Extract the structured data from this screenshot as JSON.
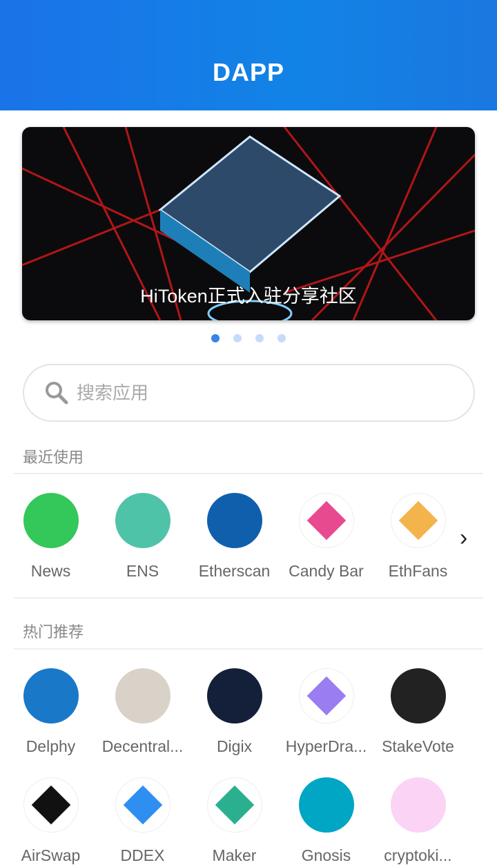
{
  "header": {
    "title": "DAPP"
  },
  "banner": {
    "caption": "HiToken正式入驻分享社区",
    "slides": 4,
    "active": 0
  },
  "search": {
    "placeholder": "搜索应用"
  },
  "recent": {
    "title": "最近使用",
    "apps": [
      {
        "name": "News",
        "color": "#34c759"
      },
      {
        "name": "ENS",
        "color": "#4fc3a8"
      },
      {
        "name": "Etherscan",
        "color": "#0f5fad"
      },
      {
        "name": "Candy Bar",
        "color": "#e84a8f"
      },
      {
        "name": "EthFans",
        "color": "#f2b44b"
      }
    ]
  },
  "hot": {
    "title": "热门推荐",
    "apps": [
      {
        "name": "Delphy",
        "color": "#1a78c8"
      },
      {
        "name": "Decentral...",
        "color": "#d8d2c8"
      },
      {
        "name": "Digix",
        "color": "#14203a"
      },
      {
        "name": "HyperDra...",
        "color": "#9a7df0"
      },
      {
        "name": "StakeVote",
        "color": "#222222"
      },
      {
        "name": "AirSwap",
        "color": "#111111"
      },
      {
        "name": "DDEX",
        "color": "#2f8ff0"
      },
      {
        "name": "Maker",
        "color": "#2bb08f"
      },
      {
        "name": "Gnosis",
        "color": "#00a6c4"
      },
      {
        "name": "cryptoki...",
        "color": "#fbd3f5"
      }
    ]
  }
}
